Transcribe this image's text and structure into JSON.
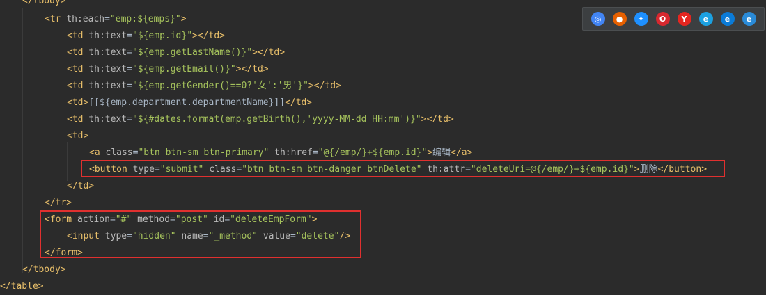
{
  "code_lines": [
    {
      "id": "l0",
      "parts": [
        [
          "tag",
          "</tbody>"
        ]
      ]
    },
    {
      "id": "l1",
      "parts": [
        [
          "tag",
          "<tr "
        ],
        [
          "attr",
          "th:each"
        ],
        [
          "plain",
          "="
        ],
        [
          "val",
          "\"emp:${emps}\""
        ],
        [
          "tag",
          ">"
        ]
      ]
    },
    {
      "id": "l2",
      "parts": [
        [
          "tag",
          "<td "
        ],
        [
          "attr",
          "th:text"
        ],
        [
          "plain",
          "="
        ],
        [
          "val",
          "\"${emp.id}\""
        ],
        [
          "tag",
          "></td>"
        ]
      ]
    },
    {
      "id": "l3",
      "parts": [
        [
          "tag",
          "<td "
        ],
        [
          "attr",
          "th:text"
        ],
        [
          "plain",
          "="
        ],
        [
          "val",
          "\"${emp.getLastName()}\""
        ],
        [
          "tag",
          "></td>"
        ]
      ]
    },
    {
      "id": "l4",
      "parts": [
        [
          "tag",
          "<td "
        ],
        [
          "attr",
          "th:text"
        ],
        [
          "plain",
          "="
        ],
        [
          "val",
          "\"${emp.getEmail()}\""
        ],
        [
          "tag",
          "></td>"
        ]
      ]
    },
    {
      "id": "l5",
      "parts": [
        [
          "tag",
          "<td "
        ],
        [
          "attr",
          "th:text"
        ],
        [
          "plain",
          "="
        ],
        [
          "val",
          "\"${emp.getGender()==0?'女':'男'}\""
        ],
        [
          "tag",
          "></td>"
        ]
      ]
    },
    {
      "id": "l6",
      "parts": [
        [
          "tag",
          "<td>"
        ],
        [
          "plain",
          "[[${emp.department.departmentName}]]"
        ],
        [
          "tag",
          "</td>"
        ]
      ]
    },
    {
      "id": "l7",
      "parts": [
        [
          "tag",
          "<td "
        ],
        [
          "attr",
          "th:text"
        ],
        [
          "plain",
          "="
        ],
        [
          "val",
          "\"${#dates.format(emp.getBirth(),'yyyy-MM-dd HH:mm')}\""
        ],
        [
          "tag",
          "></td>"
        ]
      ]
    },
    {
      "id": "l8",
      "parts": [
        [
          "tag",
          "<td>"
        ]
      ]
    },
    {
      "id": "l9",
      "parts": [
        [
          "tag",
          "<a "
        ],
        [
          "attr",
          "class"
        ],
        [
          "plain",
          "="
        ],
        [
          "val",
          "\"btn btn-sm btn-primary\""
        ],
        [
          "plain",
          " "
        ],
        [
          "attr",
          "th:href"
        ],
        [
          "plain",
          "="
        ],
        [
          "val",
          "\"@{/emp/}+${emp.id}\""
        ],
        [
          "tag",
          ">"
        ],
        [
          "plain",
          "编辑"
        ],
        [
          "tag",
          "</a>"
        ]
      ]
    },
    {
      "id": "l10",
      "parts": [
        [
          "tag",
          "<button "
        ],
        [
          "attr",
          "type"
        ],
        [
          "plain",
          "="
        ],
        [
          "val",
          "\"submit\""
        ],
        [
          "plain",
          " "
        ],
        [
          "attr",
          "class"
        ],
        [
          "plain",
          "="
        ],
        [
          "val",
          "\"btn btn-sm btn-danger btnDelete\""
        ],
        [
          "plain",
          " "
        ],
        [
          "attr",
          "th:attr"
        ],
        [
          "plain",
          "="
        ],
        [
          "val",
          "\"deleteUri=@{/emp/}+${emp.id}\""
        ],
        [
          "tag",
          ">"
        ],
        [
          "plain",
          "删除"
        ],
        [
          "tag",
          "</button>"
        ]
      ]
    },
    {
      "id": "l11",
      "parts": [
        [
          "tag",
          "</td>"
        ]
      ]
    },
    {
      "id": "l12",
      "parts": [
        [
          "tag",
          "</tr>"
        ]
      ]
    },
    {
      "id": "l13",
      "parts": [
        [
          "tag",
          "<form "
        ],
        [
          "attr",
          "action"
        ],
        [
          "plain",
          "="
        ],
        [
          "val",
          "\"#\""
        ],
        [
          "plain",
          " "
        ],
        [
          "attr",
          "method"
        ],
        [
          "plain",
          "="
        ],
        [
          "val",
          "\"post\""
        ],
        [
          "plain",
          " "
        ],
        [
          "attr",
          "id"
        ],
        [
          "plain",
          "="
        ],
        [
          "val",
          "\"deleteEmpForm\""
        ],
        [
          "tag",
          ">"
        ]
      ]
    },
    {
      "id": "l14",
      "parts": [
        [
          "tag",
          "<input "
        ],
        [
          "attr",
          "type"
        ],
        [
          "plain",
          "="
        ],
        [
          "val",
          "\"hidden\""
        ],
        [
          "plain",
          " "
        ],
        [
          "attr",
          "name"
        ],
        [
          "plain",
          "="
        ],
        [
          "val",
          "\"_method\""
        ],
        [
          "plain",
          " "
        ],
        [
          "attr",
          "value"
        ],
        [
          "plain",
          "="
        ],
        [
          "val",
          "\"delete\""
        ],
        [
          "tag",
          "/>"
        ]
      ]
    },
    {
      "id": "l15",
      "parts": [
        [
          "tag",
          "</form>"
        ]
      ]
    },
    {
      "id": "l16",
      "parts": [
        [
          "tag",
          "</tbody>"
        ]
      ]
    },
    {
      "id": "l17",
      "parts": [
        [
          "tag",
          "</table>"
        ]
      ]
    }
  ],
  "browser_icons": [
    {
      "name": "chrome-icon",
      "color": "#4285f4",
      "glyph": "◎"
    },
    {
      "name": "firefox-icon",
      "color": "#e66000",
      "glyph": "●"
    },
    {
      "name": "safari-icon",
      "color": "#1e90ff",
      "glyph": "✦"
    },
    {
      "name": "opera-icon",
      "color": "#d7282f",
      "glyph": "O"
    },
    {
      "name": "yandex-icon",
      "color": "#e52620",
      "glyph": "Y"
    },
    {
      "name": "ie-icon",
      "color": "#1ba1e2",
      "glyph": "e"
    },
    {
      "name": "edge-icon",
      "color": "#0a7bd8",
      "glyph": "e"
    },
    {
      "name": "edge-legacy-icon",
      "color": "#2a8bd8",
      "glyph": "e"
    }
  ]
}
